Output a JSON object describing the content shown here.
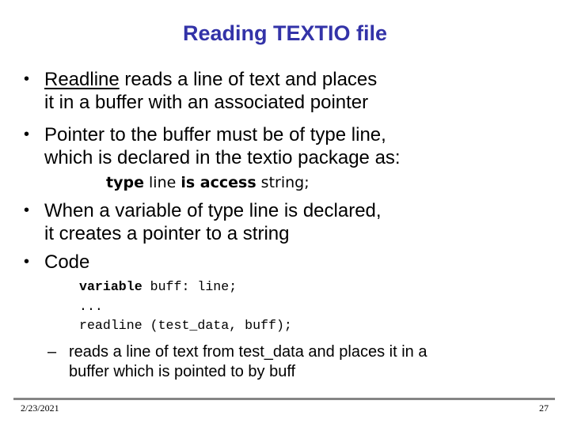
{
  "slide": {
    "title": "Reading TEXTIO file",
    "title_color": "#3333a8",
    "bullets": [
      {
        "marker": "•",
        "lines": [
          {
            "underlined": "Readline",
            "rest": " reads a line of text and places"
          },
          {
            "text": "it in a buffer with an associated pointer"
          }
        ]
      },
      {
        "marker": "•",
        "lines": [
          {
            "text": "Pointer to the buffer must be of type line,"
          },
          {
            "text": "which is declared in the textio package as:"
          }
        ]
      },
      {
        "marker": "•",
        "lines": [
          {
            "text": "When a variable of type line is declared,"
          },
          {
            "text": "it creates a pointer to a string"
          }
        ]
      },
      {
        "marker": "•",
        "lines": [
          {
            "text": "Code"
          }
        ]
      }
    ],
    "declaration": {
      "kw1": "type",
      "word1": " line ",
      "kw2": "is access",
      "word2": " string;"
    },
    "code": {
      "line1_kw": "variable",
      "line1_rest": " buff: line;",
      "line2": "...",
      "line3": "readline (test_data, buff);"
    },
    "sub_bullet": {
      "marker": "–",
      "lines": [
        "reads a line of text from test_data and places it in a",
        "buffer which is pointed to by buff"
      ]
    }
  },
  "footer": {
    "date": "2/23/2021",
    "page_number": "27"
  }
}
